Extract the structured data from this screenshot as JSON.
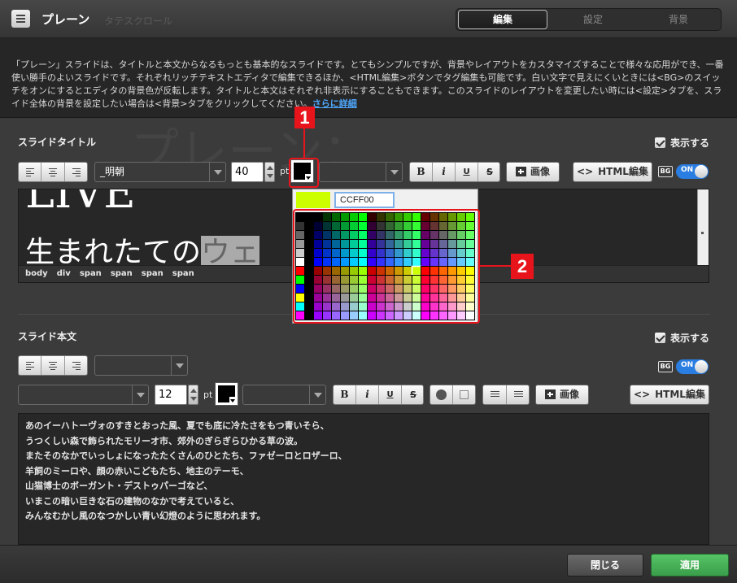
{
  "header": {
    "title": "プレーン",
    "ghost_text": "タテスクロール",
    "tabs": [
      {
        "label": "編集",
        "active": true
      },
      {
        "label": "設定",
        "active": false
      },
      {
        "label": "背景",
        "active": false
      }
    ]
  },
  "description": {
    "text": "「プレーン」スライドは、タイトルと本文からなるもっとも基本的なスライドです。とてもシンプルですが、背景やレイアウトをカスタマイズすることで様々な応用ができ、一番使い勝手のよいスライドです。それぞれリッチテキストエディタで編集できるほか、<HTML編集>ボタンでタグ編集も可能です。白い文字で見えにくいときには<BG>のスイッチをオンにするとエディタの背景色が反転します。タイトルと本文はそれぞれ非表示にすることもできます。このスライドのレイアウトを変更したい時には<設定>タブを、スライド全体の背景を設定したい場合は<背景>タブをクリックしてください。",
    "link": "さらに詳細"
  },
  "background_kana": "プレーン：",
  "title_section": {
    "label": "スライドタイトル",
    "show_label": "表示する",
    "font": "_明朝",
    "size": "40",
    "unit": "pt",
    "bold": "B",
    "italic": "i",
    "underline": "U",
    "strike": "S",
    "image_button": "画像",
    "html_button": "HTML編集",
    "bg_badge": "BG",
    "toggle": "ON",
    "editor_lines": [
      "LIVE",
      "生まれたての",
      "ウェ"
    ],
    "status_path": [
      "body",
      "div",
      "span",
      "span",
      "span",
      "span"
    ]
  },
  "body_section": {
    "label": "スライド本文",
    "show_label": "表示する",
    "size": "12",
    "unit": "pt",
    "bold": "B",
    "italic": "i",
    "underline": "U",
    "strike": "S",
    "image_button": "画像",
    "html_button": "HTML編集",
    "bg_badge": "BG",
    "toggle": "ON",
    "text_lines": [
      "あのイーハトーヴォのすきとおった風、夏でも底に冷たさをもつ青いそら、",
      "うつくしい森で飾られたモリーオ市、郊外のぎらぎらひかる草の波。",
      "またそのなかでいっしょになったたくさんのひとたち、ファゼーロとロザーロ、",
      "羊飼のミーロや、顔の赤いこどもたち、地主のテーモ、",
      "山猫博士のボーガント・デストゥパーゴなど、",
      "いまこの暗い巨きな石の建物のなかで考えていると、",
      "みんなむかし風のなつかしい青い幻燈のように思われます。"
    ]
  },
  "color_picker": {
    "selected_hex": "CCFF00",
    "selected_color": "#CCFF00"
  },
  "callouts": {
    "one": "1",
    "two": "2"
  },
  "footer": {
    "close_label": "閉じる",
    "apply_label": "適用"
  },
  "colors": {
    "accent_red": "#E8141B",
    "apply_green": "#3FAE52",
    "toggle_blue": "#2A7DE1",
    "link_blue": "#4FA8FF"
  }
}
